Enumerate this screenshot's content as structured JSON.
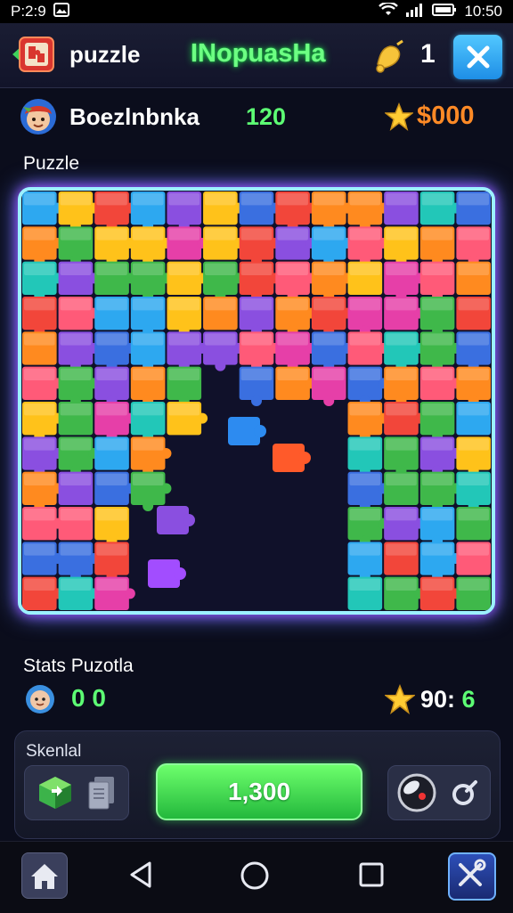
{
  "status_bar": {
    "carrier": "P:2:9",
    "time": "10:50"
  },
  "header": {
    "title": "puzzle",
    "game_name": "INopuasHa",
    "count": "1"
  },
  "player": {
    "name": "Boezlnbnka",
    "score": "120",
    "coins": "$000"
  },
  "board": {
    "label": "Puzzle"
  },
  "stats": {
    "label": "Stats Puzotla",
    "value": "0 0",
    "time_main": "90:",
    "time_accent": "6"
  },
  "panel": {
    "label": "Skenlal",
    "action_label": "1,300"
  },
  "colors": {
    "accent_green": "#5dff74",
    "coin_orange": "#ff8a26",
    "close_blue": "#2aa4f4",
    "board_glow": "#a24dff"
  },
  "icons": {
    "header_logo": "puzzle-app-icon",
    "header_bell": "bell-icon",
    "close": "close-icon",
    "coin": "star-icon",
    "home": "home-icon",
    "back": "back-triangle-icon",
    "recent": "square-icon",
    "tool": "tools-icon"
  }
}
